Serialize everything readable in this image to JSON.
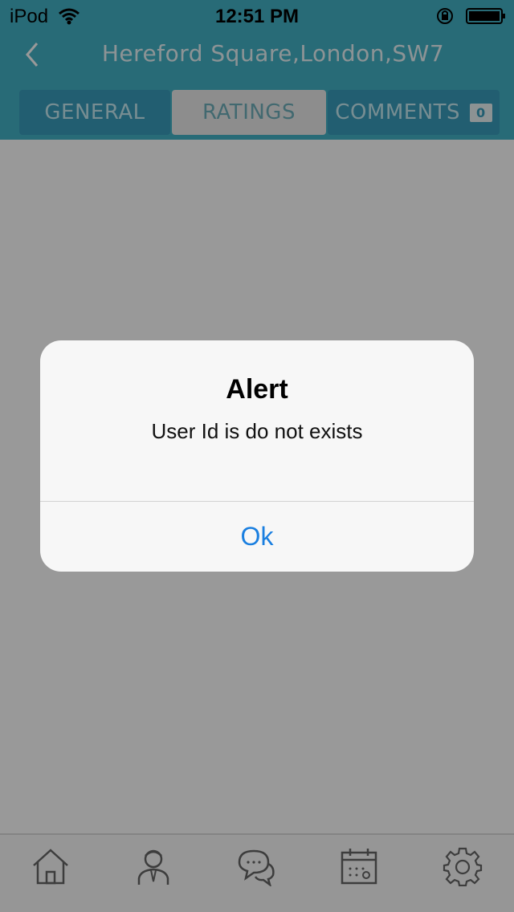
{
  "status_bar": {
    "carrier": "iPod",
    "time": "12:51 PM"
  },
  "nav": {
    "title": "Hereford Square,London,SW7"
  },
  "tabs": [
    {
      "label": "General"
    },
    {
      "label": "Ratings"
    },
    {
      "label": "Comments",
      "badge": "0"
    }
  ],
  "tab_bar": {
    "icons": [
      "home-icon",
      "agent-icon",
      "chat-bubbles-icon",
      "calendar-icon",
      "gear-icon"
    ]
  },
  "alert": {
    "title": "Alert",
    "message": "User Id is do not exists",
    "ok_label": "Ok"
  },
  "colors": {
    "brand": "#44b3c7",
    "tab_active": "#3a9dbc",
    "ok_blue": "#1a7fe0"
  }
}
